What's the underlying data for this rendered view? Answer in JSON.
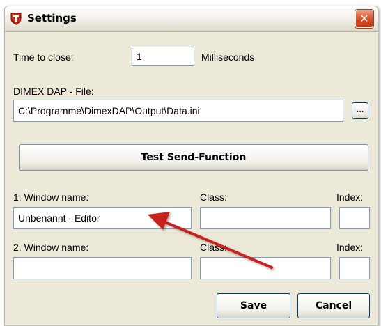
{
  "window": {
    "title": "Settings",
    "close_label": "✕"
  },
  "timing": {
    "label": "Time to close:",
    "value": "1",
    "unit": "Milliseconds"
  },
  "file": {
    "label": "DIMEX DAP - File:",
    "path": "C:\\Programme\\DimexDAP\\Output\\Data.ini",
    "browse_label": "..."
  },
  "test_button": "Test Send-Function",
  "window1": {
    "name_label": "1. Window name:",
    "class_label": "Class:",
    "index_label": "Index:",
    "name_value": "Unbenannt - Editor",
    "class_value": "",
    "index_value": ""
  },
  "window2": {
    "name_label": "2. Window name:",
    "class_label": "Class:",
    "index_label": "Index:",
    "name_value": "",
    "class_value": "",
    "index_value": ""
  },
  "buttons": {
    "save": "Save",
    "cancel": "Cancel"
  },
  "colors": {
    "dialog_bg": "#ece9d8",
    "annotation_arrow": "#c8201e",
    "button_border": "#003c74"
  }
}
